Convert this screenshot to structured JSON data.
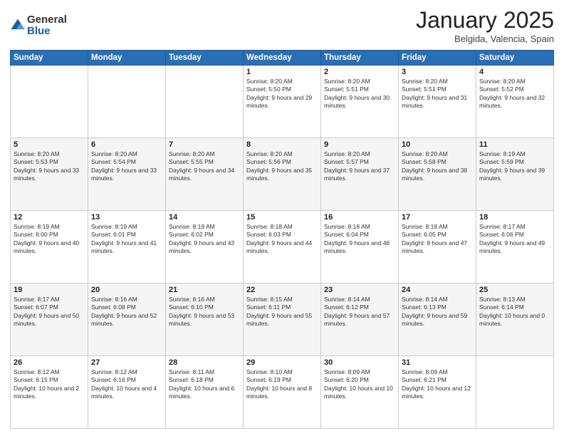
{
  "logo": {
    "general": "General",
    "blue": "Blue"
  },
  "header": {
    "month": "January 2025",
    "location": "Belgida, Valencia, Spain"
  },
  "weekdays": [
    "Sunday",
    "Monday",
    "Tuesday",
    "Wednesday",
    "Thursday",
    "Friday",
    "Saturday"
  ],
  "weeks": [
    [
      {
        "day": "",
        "info": ""
      },
      {
        "day": "",
        "info": ""
      },
      {
        "day": "",
        "info": ""
      },
      {
        "day": "1",
        "info": "Sunrise: 8:20 AM\nSunset: 5:50 PM\nDaylight: 9 hours and 29 minutes."
      },
      {
        "day": "2",
        "info": "Sunrise: 8:20 AM\nSunset: 5:51 PM\nDaylight: 9 hours and 30 minutes."
      },
      {
        "day": "3",
        "info": "Sunrise: 8:20 AM\nSunset: 5:51 PM\nDaylight: 9 hours and 31 minutes."
      },
      {
        "day": "4",
        "info": "Sunrise: 8:20 AM\nSunset: 5:52 PM\nDaylight: 9 hours and 32 minutes."
      }
    ],
    [
      {
        "day": "5",
        "info": "Sunrise: 8:20 AM\nSunset: 5:53 PM\nDaylight: 9 hours and 33 minutes."
      },
      {
        "day": "6",
        "info": "Sunrise: 8:20 AM\nSunset: 5:54 PM\nDaylight: 9 hours and 33 minutes."
      },
      {
        "day": "7",
        "info": "Sunrise: 8:20 AM\nSunset: 5:55 PM\nDaylight: 9 hours and 34 minutes."
      },
      {
        "day": "8",
        "info": "Sunrise: 8:20 AM\nSunset: 5:56 PM\nDaylight: 9 hours and 35 minutes."
      },
      {
        "day": "9",
        "info": "Sunrise: 8:20 AM\nSunset: 5:57 PM\nDaylight: 9 hours and 37 minutes."
      },
      {
        "day": "10",
        "info": "Sunrise: 8:20 AM\nSunset: 5:58 PM\nDaylight: 9 hours and 38 minutes."
      },
      {
        "day": "11",
        "info": "Sunrise: 8:19 AM\nSunset: 5:59 PM\nDaylight: 9 hours and 39 minutes."
      }
    ],
    [
      {
        "day": "12",
        "info": "Sunrise: 8:19 AM\nSunset: 6:00 PM\nDaylight: 9 hours and 40 minutes."
      },
      {
        "day": "13",
        "info": "Sunrise: 8:19 AM\nSunset: 6:01 PM\nDaylight: 9 hours and 41 minutes."
      },
      {
        "day": "14",
        "info": "Sunrise: 8:19 AM\nSunset: 6:02 PM\nDaylight: 9 hours and 43 minutes."
      },
      {
        "day": "15",
        "info": "Sunrise: 8:18 AM\nSunset: 6:03 PM\nDaylight: 9 hours and 44 minutes."
      },
      {
        "day": "16",
        "info": "Sunrise: 8:18 AM\nSunset: 6:04 PM\nDaylight: 9 hours and 46 minutes."
      },
      {
        "day": "17",
        "info": "Sunrise: 8:18 AM\nSunset: 6:05 PM\nDaylight: 9 hours and 47 minutes."
      },
      {
        "day": "18",
        "info": "Sunrise: 8:17 AM\nSunset: 6:06 PM\nDaylight: 9 hours and 49 minutes."
      }
    ],
    [
      {
        "day": "19",
        "info": "Sunrise: 8:17 AM\nSunset: 6:07 PM\nDaylight: 9 hours and 50 minutes."
      },
      {
        "day": "20",
        "info": "Sunrise: 8:16 AM\nSunset: 6:08 PM\nDaylight: 9 hours and 52 minutes."
      },
      {
        "day": "21",
        "info": "Sunrise: 8:16 AM\nSunset: 6:10 PM\nDaylight: 9 hours and 53 minutes."
      },
      {
        "day": "22",
        "info": "Sunrise: 8:15 AM\nSunset: 6:11 PM\nDaylight: 9 hours and 55 minutes."
      },
      {
        "day": "23",
        "info": "Sunrise: 8:14 AM\nSunset: 6:12 PM\nDaylight: 9 hours and 57 minutes."
      },
      {
        "day": "24",
        "info": "Sunrise: 8:14 AM\nSunset: 6:13 PM\nDaylight: 9 hours and 59 minutes."
      },
      {
        "day": "25",
        "info": "Sunrise: 8:13 AM\nSunset: 6:14 PM\nDaylight: 10 hours and 0 minutes."
      }
    ],
    [
      {
        "day": "26",
        "info": "Sunrise: 8:12 AM\nSunset: 6:15 PM\nDaylight: 10 hours and 2 minutes."
      },
      {
        "day": "27",
        "info": "Sunrise: 8:12 AM\nSunset: 6:16 PM\nDaylight: 10 hours and 4 minutes."
      },
      {
        "day": "28",
        "info": "Sunrise: 8:11 AM\nSunset: 6:18 PM\nDaylight: 10 hours and 6 minutes."
      },
      {
        "day": "29",
        "info": "Sunrise: 8:10 AM\nSunset: 6:19 PM\nDaylight: 10 hours and 8 minutes."
      },
      {
        "day": "30",
        "info": "Sunrise: 8:09 AM\nSunset: 6:20 PM\nDaylight: 10 hours and 10 minutes."
      },
      {
        "day": "31",
        "info": "Sunrise: 8:09 AM\nSunset: 6:21 PM\nDaylight: 10 hours and 12 minutes."
      },
      {
        "day": "",
        "info": ""
      }
    ]
  ]
}
